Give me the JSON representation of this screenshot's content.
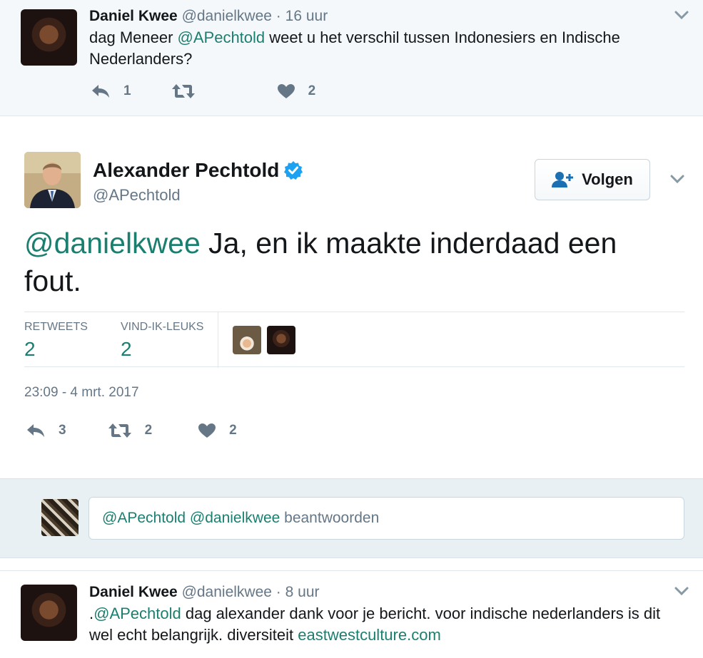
{
  "top_tweet": {
    "name": "Daniel Kwee",
    "handle": "@danielkwee",
    "separator": "·",
    "time": "16 uur",
    "text_pre": "dag Meneer ",
    "mention": "@APechtold",
    "text_post": " weet u het verschil tussen Indonesiers en Indische Nederlanders?",
    "reply_count": "1",
    "like_count": "2"
  },
  "main_tweet": {
    "name": "Alexander Pechtold",
    "handle": "@APechtold",
    "follow_label": "Volgen",
    "mention": "@danielkwee",
    "text": " Ja, en ik maakte inderdaad een fout.",
    "stats": {
      "retweets_label": "RETWEETS",
      "retweets_value": "2",
      "likes_label": "VIND-IK-LEUKS",
      "likes_value": "2"
    },
    "timestamp": "23:09 - 4 mrt. 2017",
    "reply_count": "3",
    "retweet_count": "2",
    "like_count": "2"
  },
  "reply_box": {
    "mention1": "@APechtold",
    "mention2": "@danielkwee",
    "action": "beantwoorden"
  },
  "bottom_tweet": {
    "name": "Daniel Kwee",
    "handle": "@danielkwee",
    "separator": "·",
    "time": "8 uur",
    "prefix": ".",
    "mention": "@APechtold",
    "text": " dag alexander dank voor je bericht. voor indische nederlanders is dit wel echt belangrijk. diversiteit ",
    "link": "eastwestculture.com"
  },
  "colors": {
    "link": "#1b7f6f",
    "muted": "#657786",
    "verified": "#1da1f2"
  },
  "icons": [
    "reply-icon",
    "retweet-icon",
    "heart-icon",
    "chevron-down-icon",
    "verified-icon",
    "follow-person-icon"
  ]
}
